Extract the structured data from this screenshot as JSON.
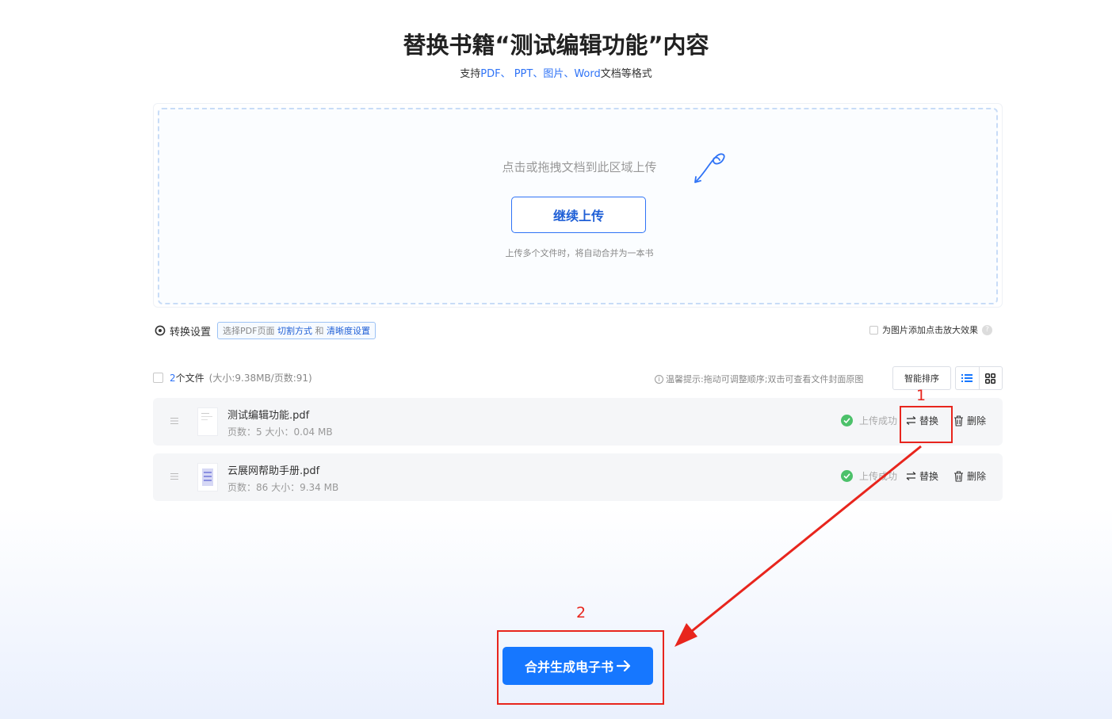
{
  "header": {
    "title": "替换书籍“测试编辑功能”内容",
    "subtitle_prefix": "支持",
    "subtitle_pdf": "PDF、",
    "subtitle_ppt": "PPT、",
    "subtitle_img": "图片、",
    "subtitle_word": "Word",
    "subtitle_suffix": "文档等格式"
  },
  "upload": {
    "hint": "点击或拖拽文档到此区域上传",
    "continue_label": "继续上传",
    "note": "上传多个文件时，将自动合并为一本书"
  },
  "settings": {
    "label": "转换设置",
    "tag_prefix": "选择PDF页面",
    "tag_link1": "切割方式",
    "tag_and": "和",
    "tag_link2": "清晰度设置",
    "zoom_label": "为图片添加点击放大效果",
    "help_glyph": "?"
  },
  "files": {
    "count_text": "2",
    "count_unit": "个文件",
    "summary_detail": "(大小:9.38MB/页数:91)",
    "tip": "温馨提示:拖动可调整顺序;双击可查看文件封面原图",
    "info_glyph": "i",
    "smart_sort_label": "智能排序",
    "items": [
      {
        "name": "测试编辑功能.pdf",
        "meta": "页数：5  大小：0.04 MB",
        "status": "上传成功",
        "replace": "替换",
        "delete": "删除"
      },
      {
        "name": "云展网帮助手册.pdf",
        "meta": "页数：86  大小：9.34 MB",
        "status": "上传成功",
        "replace": "替换",
        "delete": "删除"
      }
    ]
  },
  "merge_label": "合并生成电子书",
  "annotations": {
    "step1": "1",
    "step2": "2"
  },
  "colors": {
    "accent": "#1677ff",
    "annotation": "#e8251d",
    "success": "#4cc16a"
  }
}
